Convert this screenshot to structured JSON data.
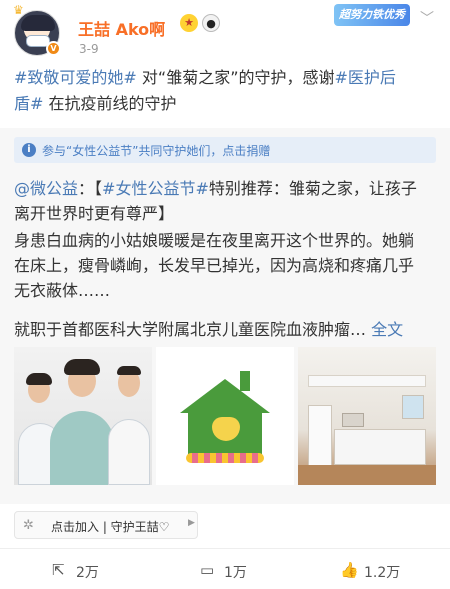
{
  "post": {
    "username": "王喆 Ako啊",
    "date": "3-9",
    "honor_badge": "超努力铁优秀",
    "text_line1": [
      {
        "text": "#致敬可爱的她#",
        "tag": true
      },
      {
        "text": " 对“雏菊之家”的守护，感谢",
        "tag": false
      },
      {
        "text": "#医护后",
        "tag": true
      }
    ],
    "text_line2": [
      {
        "text": "盾#",
        "tag": true
      },
      {
        "text": " 在抗疫前线的守护",
        "tag": false
      }
    ]
  },
  "repost": {
    "donate_label": "参与“女性公益节”共同守护她们，点击捐赠",
    "line1": [
      {
        "text": "@微公益",
        "tag": true
      },
      {
        "text": "：【",
        "tag": false
      },
      {
        "text": "#女性公益节#",
        "tag": true
      },
      {
        "text": "特别推荐：雏菊之家，让孩子",
        "tag": false
      }
    ],
    "line2": "离开世界时更有尊严】",
    "line3": "身患白血病的小姑娘暖暖是在夜里离开这个世界的。她躺",
    "line4": "在床上，瘦骨嶙峋，长发早已掉光，因为高烧和疼痛几乎",
    "line5": "无衣蔽体……",
    "line6": "就职于首都医科大学附属北京儿童医院血液肿瘤… ",
    "full_text_link": "全文",
    "images": [
      "doctors-photo",
      "daisy-home-logo",
      "kitchen-photo"
    ]
  },
  "super_topic": {
    "label": "点击加入 | 守护王喆♡"
  },
  "actions": {
    "repost_count": "2万",
    "comment_count": "1万",
    "like_count": "1.2万"
  },
  "colors": {
    "username": "#f86f27",
    "tag": "#4a7ab5",
    "repost_bg": "#f7f7f7",
    "donate_bg": "#e6eef8"
  },
  "icons": [
    "vip-badge-icon",
    "more-chevron-icon",
    "info-icon",
    "super-topic-icon",
    "repost-icon",
    "comment-icon",
    "like-icon"
  ]
}
